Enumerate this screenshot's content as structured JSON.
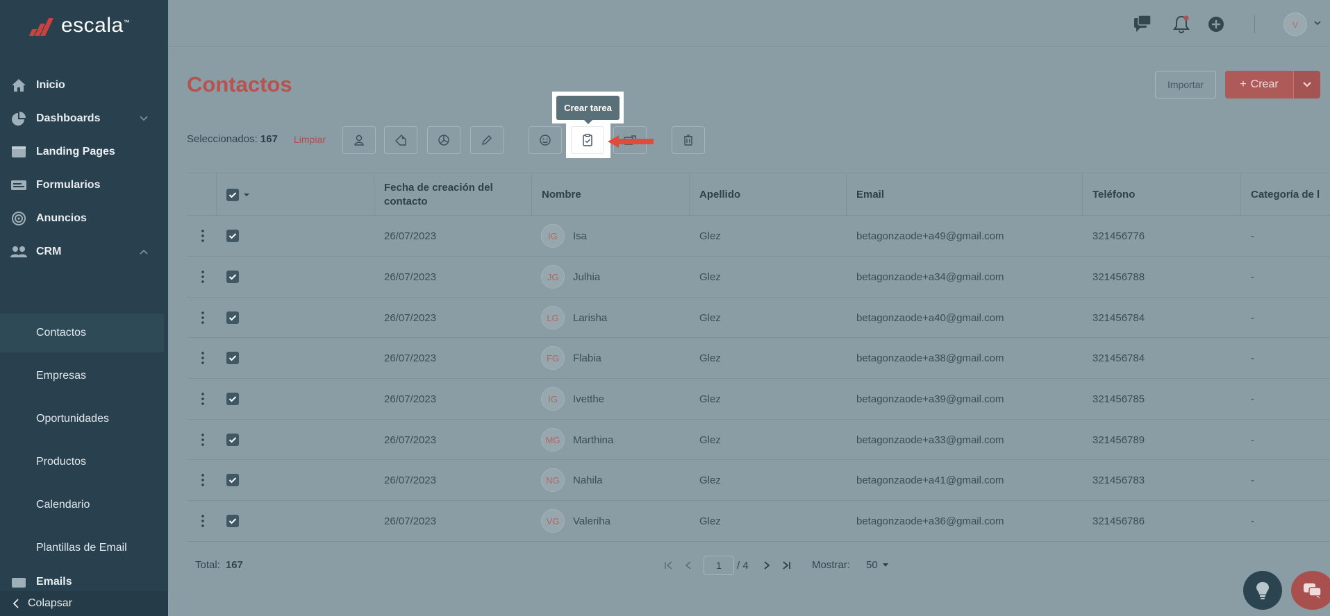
{
  "brand": {
    "name": "escala",
    "tm": "™"
  },
  "sidebar": {
    "items": [
      {
        "label": "Inicio",
        "icon": "home-icon"
      },
      {
        "label": "Dashboards",
        "icon": "pie-chart-icon"
      },
      {
        "label": "Landing Pages",
        "icon": "browser-window-icon"
      },
      {
        "label": "Formularios",
        "icon": "form-icon"
      },
      {
        "label": "Anuncios",
        "icon": "target-icon"
      },
      {
        "label": "CRM",
        "icon": "people-icon"
      }
    ],
    "crm_sub": [
      {
        "label": "Contactos"
      },
      {
        "label": "Empresas"
      },
      {
        "label": "Oportunidades"
      },
      {
        "label": "Productos"
      },
      {
        "label": "Calendario"
      },
      {
        "label": "Plantillas de Email"
      }
    ],
    "partial_item": "Emails",
    "collapse_label": "Colapsar"
  },
  "topbar": {
    "avatar_initial": "V"
  },
  "page": {
    "title": "Contactos",
    "import_label": "Importar",
    "create_label": "Crear",
    "create_plus": "+"
  },
  "toolbar": {
    "selected_label": "Seleccionados:",
    "selected_count": "167",
    "clear_label": "Limpiar",
    "tooltip": "Crear tarea"
  },
  "table": {
    "headers": [
      "Fecha de creación del contacto",
      "Nombre",
      "Apellido",
      "Email",
      "Teléfono",
      "Categoría de l"
    ],
    "rows": [
      {
        "date": "26/07/2023",
        "initials": "IG",
        "name": "Isa",
        "last": "Glez",
        "email": "betagonzaode+a49@gmail.com",
        "phone": "321456776",
        "category": "-"
      },
      {
        "date": "26/07/2023",
        "initials": "JG",
        "name": "Julhia",
        "last": "Glez",
        "email": "betagonzaode+a34@gmail.com",
        "phone": "321456788",
        "category": "-"
      },
      {
        "date": "26/07/2023",
        "initials": "LG",
        "name": "Larisha",
        "last": "Glez",
        "email": "betagonzaode+a40@gmail.com",
        "phone": "321456784",
        "category": "-"
      },
      {
        "date": "26/07/2023",
        "initials": "FG",
        "name": "Flabia",
        "last": "Glez",
        "email": "betagonzaode+a38@gmail.com",
        "phone": "321456784",
        "category": "-"
      },
      {
        "date": "26/07/2023",
        "initials": "IG",
        "name": "Ivetthe",
        "last": "Glez",
        "email": "betagonzaode+a39@gmail.com",
        "phone": "321456785",
        "category": "-"
      },
      {
        "date": "26/07/2023",
        "initials": "MG",
        "name": "Marthina",
        "last": "Glez",
        "email": "betagonzaode+a33@gmail.com",
        "phone": "321456789",
        "category": "-"
      },
      {
        "date": "26/07/2023",
        "initials": "NG",
        "name": "Nahila",
        "last": "Glez",
        "email": "betagonzaode+a41@gmail.com",
        "phone": "321456783",
        "category": "-"
      },
      {
        "date": "26/07/2023",
        "initials": "VG",
        "name": "Valeriha",
        "last": "Glez",
        "email": "betagonzaode+a36@gmail.com",
        "phone": "321456786",
        "category": "-"
      }
    ]
  },
  "footer": {
    "total_label": "Total:",
    "total_value": "167",
    "page_current": "1",
    "page_of": "/ 4",
    "show_label": "Mostrar:",
    "show_value": "50"
  },
  "colors": {
    "accent": "#b8524f",
    "sidebar": "#29414e",
    "overlay": "#8a9ca4"
  }
}
